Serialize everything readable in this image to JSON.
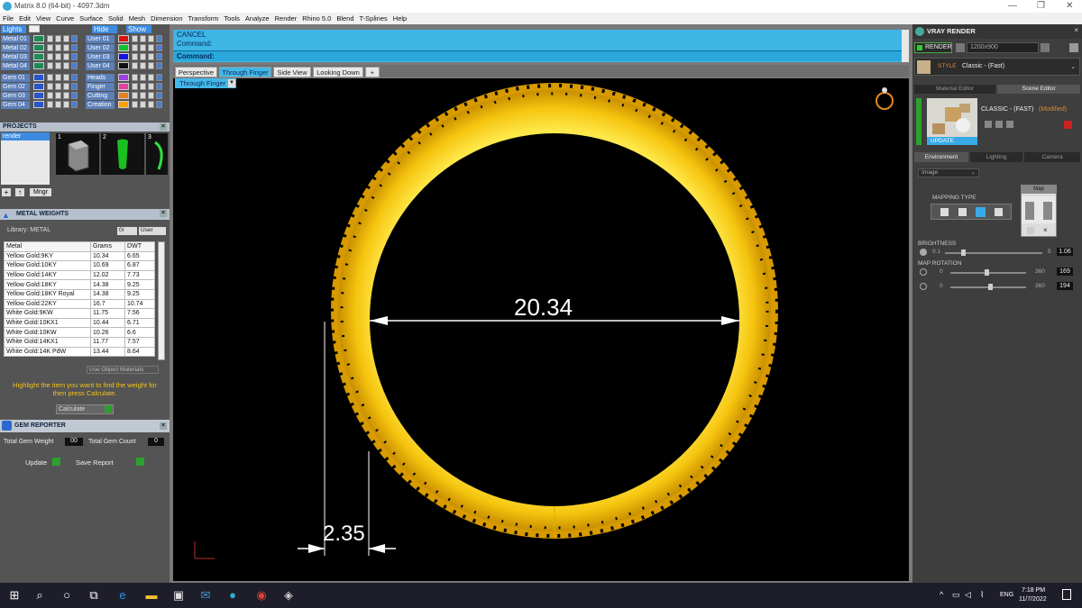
{
  "window": {
    "title": "Matrix 8.0 (64-bit) - 4097.3dm",
    "min": "—",
    "max": "❐",
    "close": "✕"
  },
  "menu": [
    "File",
    "Edit",
    "View",
    "Curve",
    "Surface",
    "Solid",
    "Mesh",
    "Dimension",
    "Transform",
    "Tools",
    "Analyze",
    "Render",
    "Rhino 5.0",
    "Blend",
    "T-Splines",
    "Help"
  ],
  "layers": {
    "header_lights": "Lights",
    "hide": "Hide",
    "show": "Show",
    "left": [
      {
        "n": "Metal 01",
        "c": "#1f8a55"
      },
      {
        "n": "Metal 02",
        "c": "#1f8a55"
      },
      {
        "n": "Metal 03",
        "c": "#1f8a55"
      },
      {
        "n": "Metal 04",
        "c": "#1f8a55"
      },
      {
        "n": "Gem 01",
        "c": "#2a55c8"
      },
      {
        "n": "Gem 02",
        "c": "#2a55c8"
      },
      {
        "n": "Gem 03",
        "c": "#2a55c8"
      },
      {
        "n": "Gem 04",
        "c": "#2a55c8"
      }
    ],
    "right": [
      {
        "n": "User 01",
        "c": "#e01010"
      },
      {
        "n": "User 02",
        "c": "#10c030"
      },
      {
        "n": "User 03",
        "c": "#1010e0"
      },
      {
        "n": "User 04",
        "c": "#101010"
      },
      {
        "n": "Heads",
        "c": "#a040e0"
      },
      {
        "n": "Finger",
        "c": "#e040a0"
      },
      {
        "n": "Cutting",
        "c": "#e08020"
      },
      {
        "n": "Creation",
        "c": "#ffa000"
      }
    ]
  },
  "projects": {
    "title": "PROJECTS",
    "item": "render",
    "thumbs": [
      "1",
      "2",
      "3"
    ],
    "mngr": "Mngr"
  },
  "metal_weights": {
    "title": "METAL WEIGHTS",
    "library": "Library: METAL",
    "toggle_a": "0r",
    "toggle_b": "User",
    "columns": [
      "Metal",
      "Grams",
      "DWT"
    ],
    "rows": [
      [
        "Yellow Gold:9KY",
        "10.34",
        "6.65"
      ],
      [
        "Yellow Gold:10KY",
        "10.69",
        "6.87"
      ],
      [
        "Yellow Gold:14KY",
        "12.02",
        "7.73"
      ],
      [
        "Yellow Gold:18KY",
        "14.38",
        "9.25"
      ],
      [
        "Yellow Gold:18KY Royal",
        "14.38",
        "9.25"
      ],
      [
        "Yellow Gold:22KY",
        "16.7",
        "10.74"
      ],
      [
        "White Gold:9KW",
        "11.75",
        "7.56"
      ],
      [
        "White Gold:10KX1",
        "10.44",
        "6.71"
      ],
      [
        "White Gold:10KW",
        "10.26",
        "6.6"
      ],
      [
        "White Gold:14KX1",
        "11.77",
        "7.57"
      ],
      [
        "White Gold:14K PdW",
        "13.44",
        "8.64"
      ]
    ],
    "use_obj": "Use Object Materials",
    "hint": "Highlight the item you want to find the weight for then press Calculate.",
    "calculate": "Calculate"
  },
  "gem_reporter": {
    "title": "GEM REPORTER",
    "total_weight_label": "Total Gem Weight",
    "total_weight": "00",
    "total_count_label": "Total Gem Count",
    "total_count": "0",
    "update": "Update",
    "save": "Save Report"
  },
  "command": {
    "line1": "CANCEL",
    "line2": "Command:",
    "prompt": "Command:"
  },
  "tabs": [
    "Perspective",
    "Through Finger",
    "Side View",
    "Looking Down",
    "+"
  ],
  "viewport": {
    "label": "Through Finger",
    "dim_main": "20.34",
    "dim_thick": "2.35"
  },
  "vray": {
    "title": "VRAY RENDER",
    "render": "RENDER",
    "resolution": "1200x900",
    "style_label": "STYLE",
    "style": "Classic - (Fast)",
    "tab_material": "Material Editor",
    "tab_scene": "Scene Editor",
    "preset": "CLASSIC - (FAST)",
    "modified": "(Modified)",
    "update": "UPDATE",
    "env_tabs": [
      "Environment",
      "Lighting",
      "Camera"
    ],
    "env_select": "Image",
    "mapping": "MAPPING TYPE",
    "map": "Map",
    "brightness_label": "BRIGHTNESS",
    "b_min": "0.1",
    "b_max": "5",
    "b_val": "1.06",
    "rotation_label": "MAP ROTATION",
    "r1_min": "0",
    "r1_max": "360",
    "r1_val": "169",
    "r2_min": "0",
    "r2_max": "360",
    "r2_val": "194"
  },
  "taskbar": {
    "lang": "ENG",
    "time": "7:18 PM",
    "date": "11/7/2022"
  }
}
